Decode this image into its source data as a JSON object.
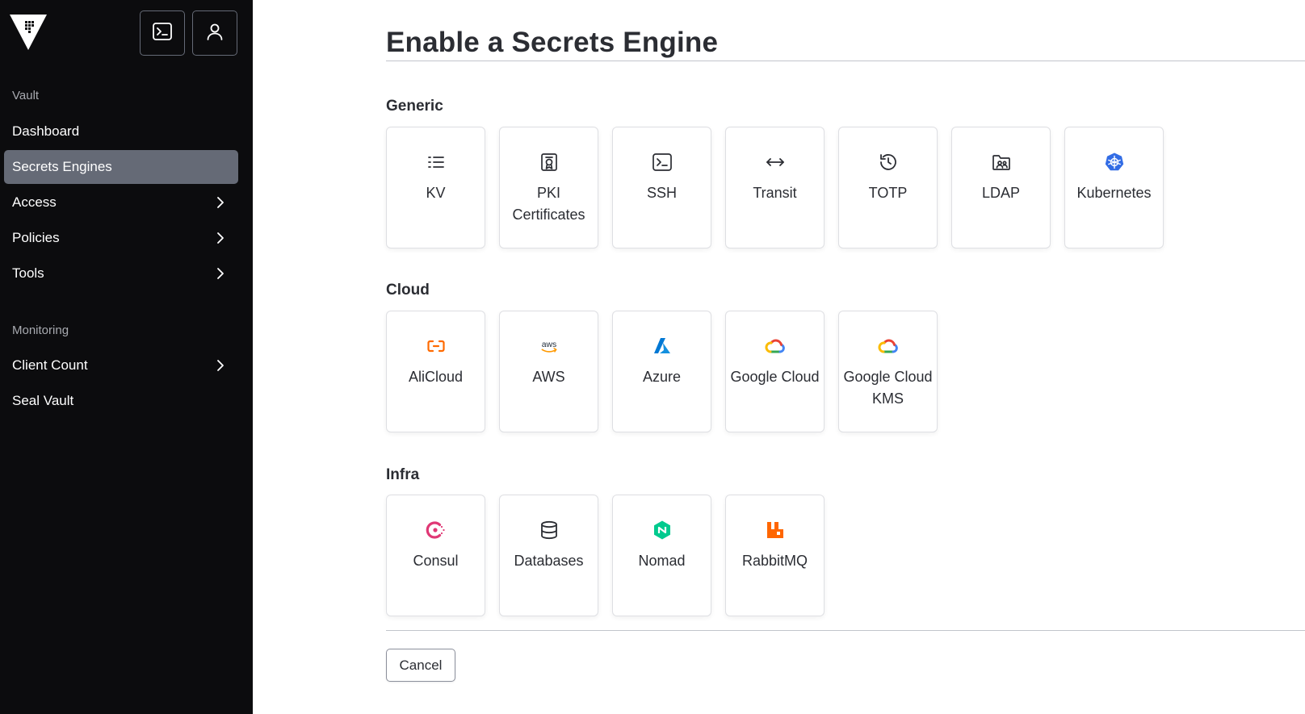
{
  "sidebar": {
    "logo_icon": "vault-logo-icon",
    "console_icon": "terminal-icon",
    "user_icon": "user-icon",
    "sections": [
      {
        "label": "Vault"
      },
      {
        "label": "Monitoring"
      }
    ],
    "items": [
      {
        "label": "Dashboard",
        "active": false,
        "has_chevron": false
      },
      {
        "label": "Secrets Engines",
        "active": true,
        "has_chevron": false
      },
      {
        "label": "Access",
        "active": false,
        "has_chevron": true
      },
      {
        "label": "Policies",
        "active": false,
        "has_chevron": true
      },
      {
        "label": "Tools",
        "active": false,
        "has_chevron": true
      },
      {
        "label": "Client Count",
        "active": false,
        "has_chevron": true
      },
      {
        "label": "Seal Vault",
        "active": false,
        "has_chevron": false
      }
    ]
  },
  "main": {
    "title": "Enable a Secrets Engine",
    "groups": [
      {
        "title": "Generic",
        "engines": [
          {
            "label": "KV",
            "icon": "list-icon"
          },
          {
            "label": "PKI Certificates",
            "icon": "certificate-icon"
          },
          {
            "label": "SSH",
            "icon": "terminal-icon"
          },
          {
            "label": "Transit",
            "icon": "arrows-exchange-icon"
          },
          {
            "label": "TOTP",
            "icon": "history-clock-icon"
          },
          {
            "label": "LDAP",
            "icon": "folder-users-icon"
          },
          {
            "label": "Kubernetes",
            "icon": "kubernetes-icon"
          }
        ]
      },
      {
        "title": "Cloud",
        "engines": [
          {
            "label": "AliCloud",
            "icon": "alicloud-icon"
          },
          {
            "label": "AWS",
            "icon": "aws-icon"
          },
          {
            "label": "Azure",
            "icon": "azure-icon"
          },
          {
            "label": "Google Cloud",
            "icon": "google-cloud-icon"
          },
          {
            "label": "Google Cloud KMS",
            "icon": "google-cloud-icon"
          }
        ]
      },
      {
        "title": "Infra",
        "engines": [
          {
            "label": "Consul",
            "icon": "consul-icon"
          },
          {
            "label": "Databases",
            "icon": "database-icon"
          },
          {
            "label": "Nomad",
            "icon": "nomad-icon"
          },
          {
            "label": "RabbitMQ",
            "icon": "rabbitmq-icon"
          }
        ]
      }
    ],
    "cancel_label": "Cancel"
  },
  "colors": {
    "sidebar_bg": "#0c0c0e",
    "active_item_bg": "#656a76",
    "kubernetes": "#326ce5",
    "alicloud": "#ff6a00",
    "azure": "#0078d4",
    "consul": "#e03875",
    "nomad": "#00ca8e",
    "rabbitmq": "#ff6600"
  }
}
